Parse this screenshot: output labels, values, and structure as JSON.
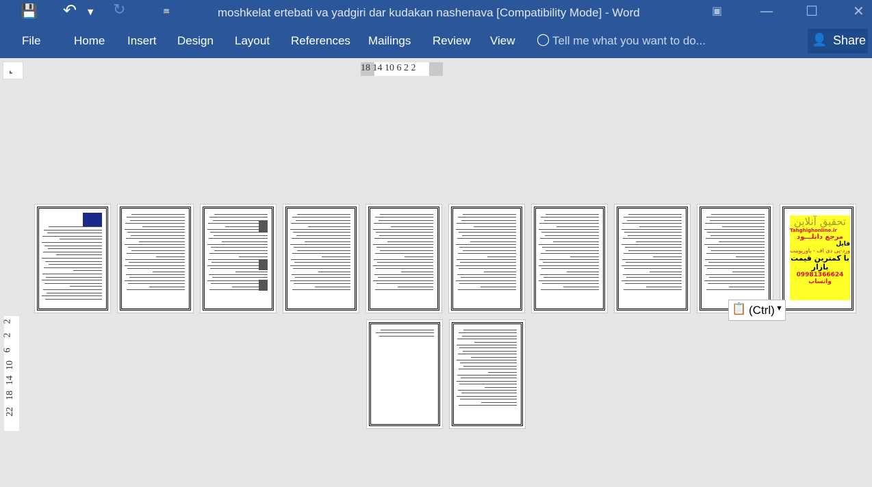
{
  "window": {
    "title": "moshkelat ertebati va yadgiri dar kudakan nashenava [Compatibility Mode] - Word"
  },
  "menu": {
    "tabs": [
      "File",
      "Home",
      "Insert",
      "Design",
      "Layout",
      "References",
      "Mailings",
      "Review",
      "View"
    ],
    "tell_me": "Tell me what you want to do...",
    "share": "Share"
  },
  "ruler": {
    "horizontal": "18 14 10 6 2 2",
    "vertical": [
      "2",
      "2",
      "6",
      "10",
      "14",
      "18",
      "22"
    ]
  },
  "ad_page": {
    "title": "تحقیق آنلاین",
    "site": "Tahghighonline.ir",
    "line1": "مرجع دانلـــود",
    "line2": "فایل",
    "line3": "ورد-پی دی اف - پاورپوینت",
    "line4": "با کمترین قیمت بازار",
    "phone": "09981366624 واتساپ"
  },
  "paste_options": {
    "label": "(Ctrl)"
  },
  "colors": {
    "ribbon": "#2b579a",
    "ad_background": "#ffff2a"
  }
}
